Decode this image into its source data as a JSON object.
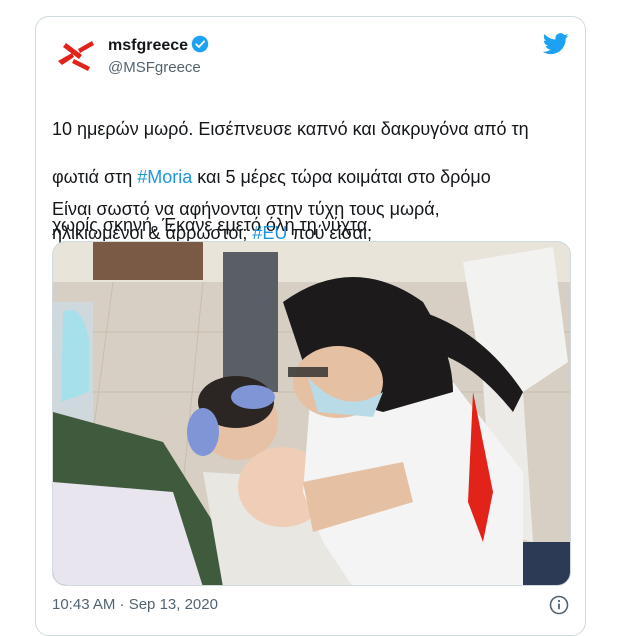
{
  "account": {
    "display_name": "msfgreece",
    "handle": "@MSFgreece",
    "verified": true
  },
  "tweet": {
    "line1_a": "10 ημερών μωρό. Εισέπνευσε καπνό και δακρυγόνα από τη",
    "line2_a": "φωτιά στη ",
    "hashtag1": "#Moria",
    "line2_b": " και 5 μέρες τώρα κοιμάται στο δρόμο",
    "line3": "χωρίς σκηνή. Έκανε εμετό όλη τη νύχτα.",
    "line4": "Είναι σωστό να αφήνονται στην τύχη τους μωρά,",
    "line5_a": "ηλικιωμένοι & άρρωστοι; ",
    "hashtag2": "#EU",
    "line5_b": " πού είσαι;"
  },
  "footer": {
    "timestamp": "10:43 AM · Sep 13, 2020"
  },
  "icons": {
    "brand": "msf-logo-icon",
    "verified": "verified-badge-icon",
    "platform": "twitter-bird-icon",
    "info": "info-icon"
  },
  "colors": {
    "link": "#1b95e0",
    "brand_red": "#e2231a",
    "twitter_blue": "#1da1f2",
    "muted": "#536471"
  }
}
